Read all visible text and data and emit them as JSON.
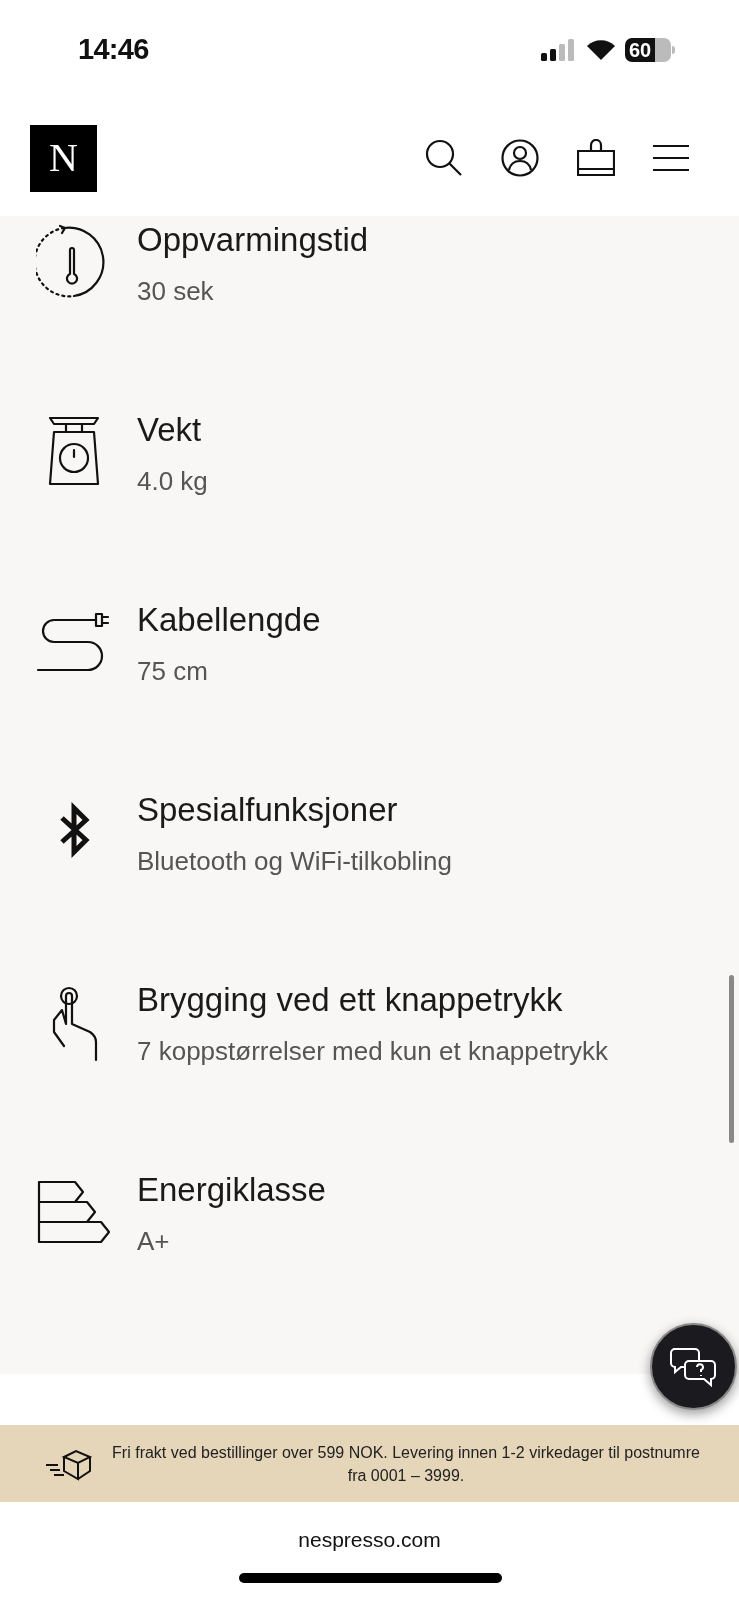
{
  "status_bar": {
    "time": "14:46",
    "battery": "60"
  },
  "header": {
    "logo": "N"
  },
  "specs": [
    {
      "title": "Oppvarmingstid",
      "value": "30 sek"
    },
    {
      "title": "Vekt",
      "value": "4.0 kg"
    },
    {
      "title": "Kabellengde",
      "value": "75 cm"
    },
    {
      "title": "Spesialfunksjoner",
      "value": "Bluetooth og WiFi-tilkobling"
    },
    {
      "title": "Brygging ved ett knappetrykk",
      "value": "7 koppstørrelser med kun et knappetrykk"
    },
    {
      "title": "Energiklasse",
      "value": "A+"
    }
  ],
  "shipping_banner": {
    "text": "Fri frakt ved bestillinger over 599 NOK. Levering innen 1-2 virkedager til postnumre fra 0001 – 3999."
  },
  "address_bar": {
    "url": "nespresso.com"
  }
}
